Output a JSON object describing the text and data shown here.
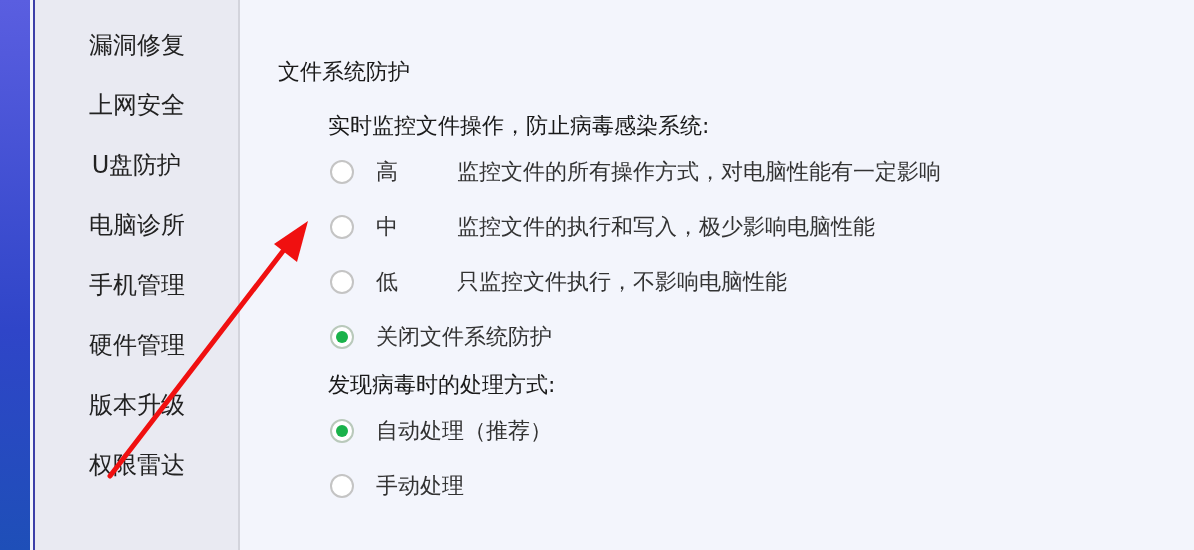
{
  "sidebar": {
    "items": [
      {
        "label": "漏洞修复"
      },
      {
        "label": "上网安全"
      },
      {
        "label": "U盘防护"
      },
      {
        "label": "电脑诊所"
      },
      {
        "label": "手机管理"
      },
      {
        "label": "硬件管理"
      },
      {
        "label": "版本升级"
      },
      {
        "label": "权限雷达"
      }
    ]
  },
  "section": {
    "title": "文件系统防护",
    "groups": [
      {
        "prompt": "实时监控文件操作，防止病毒感染系统:",
        "options": [
          {
            "kind": "graded",
            "grade": "高",
            "description": "监控文件的所有操作方式，对电脑性能有一定影响",
            "selected": false
          },
          {
            "kind": "graded",
            "grade": "中",
            "description": "监控文件的执行和写入，极少影响电脑性能",
            "selected": false
          },
          {
            "kind": "graded",
            "grade": "低",
            "description": "只监控文件执行，不影响电脑性能",
            "selected": false
          },
          {
            "kind": "plain",
            "label": "关闭文件系统防护",
            "selected": true
          }
        ]
      },
      {
        "prompt": "发现病毒时的处理方式:",
        "options": [
          {
            "kind": "plain",
            "label": "自动处理（推荐）",
            "selected": true
          },
          {
            "kind": "plain",
            "label": "手动处理",
            "selected": false
          }
        ]
      }
    ]
  },
  "annotations": [
    {
      "kind": "arrow"
    }
  ]
}
